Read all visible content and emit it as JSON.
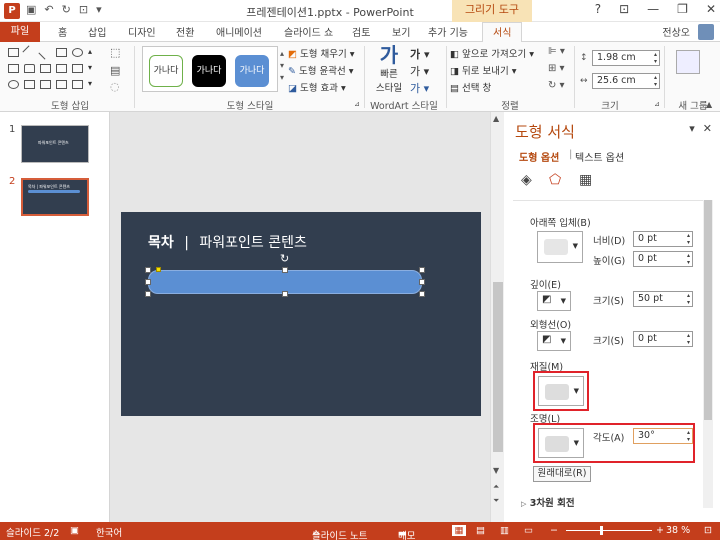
{
  "window": {
    "title": "프레젠테이션1.pptx - PowerPoint",
    "context_tab_group": "그리기 도구",
    "user": "전상오"
  },
  "ribbon_tabs": [
    "파일",
    "홈",
    "삽입",
    "디자인",
    "전환",
    "애니메이션",
    "슬라이드 쇼",
    "검토",
    "보기",
    "추가 기능",
    "서식"
  ],
  "active_tab": "서식",
  "ribbon": {
    "insert_shapes_label": "도형 삽입",
    "shape_styles_label": "도형 스타일",
    "style_samples": [
      "가나다",
      "가나다",
      "가나다"
    ],
    "fill_label": "도형 채우기",
    "outline_label": "도형 윤곽선",
    "effects_label": "도형 효과",
    "quick_styles_label": "빠른\n스타일",
    "quick_styles_l1": "빠른",
    "quick_styles_l2": "스타일",
    "wordart_label": "WordArt 스타일",
    "bring_forward": "앞으로 가져오기",
    "send_backward": "뒤로 보내기",
    "selection_pane": "선택 창",
    "arrange_label": "정렬",
    "height_value": "1.98 cm",
    "width_value": "25.6 cm",
    "size_label": "크기",
    "new_group_label": "새 그룹"
  },
  "slides": [
    {
      "number": "1",
      "thumb_text": "파워포인트 콘텐츠"
    },
    {
      "number": "2",
      "thumb_text": "목차 | 파워포인트 콘텐츠"
    }
  ],
  "slide_content": {
    "title_bold": "목차",
    "title_sep": "|",
    "title_rest": "파워포인트 콘텐츠"
  },
  "format_pane": {
    "title": "도형 서식",
    "tab_shape_options": "도형 옵션",
    "tab_text_options": "텍스트 옵션",
    "bottom_bevel_label": "아래쪽 입체(B)",
    "width_label": "너비(D)",
    "width_value": "0 pt",
    "height_label": "높이(G)",
    "height_value": "0 pt",
    "depth_label": "깊이(E)",
    "depth_size_label": "크기(S)",
    "depth_size_value": "50 pt",
    "contour_label": "외형선(O)",
    "contour_size_label": "크기(S)",
    "contour_size_value": "0 pt",
    "material_label": "재질(M)",
    "lighting_label": "조명(L)",
    "angle_label": "각도(A)",
    "angle_value": "30°",
    "reset_button": "원래대로(R)",
    "rotation_section": "3차원 회전"
  },
  "status": {
    "slide_counter": "슬라이드 2/2",
    "language": "한국어",
    "notes_label": "슬라이드 노트",
    "comments_label": "메모",
    "zoom": "38 %"
  },
  "colors": {
    "accent": "#c43e1c",
    "slide_bg": "#323e4f",
    "shape_fill": "#5b8fd3",
    "highlight_box": "#e0232a"
  }
}
